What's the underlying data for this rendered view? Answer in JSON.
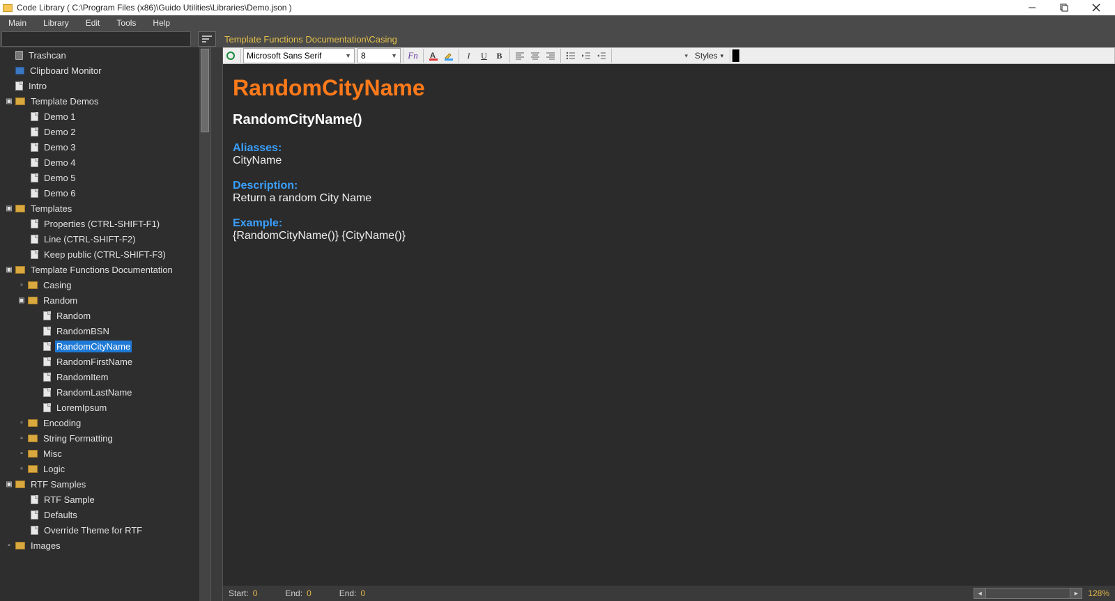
{
  "window": {
    "title": "Code Library ( C:\\Program Files (x86)\\Guido Utilities\\Libraries\\Demo.json )"
  },
  "menu": [
    "Main",
    "Library",
    "Edit",
    "Tools",
    "Help"
  ],
  "toolbar1": {
    "breadcrumb": "Template Functions Documentation\\Casing"
  },
  "editor_toolbar": {
    "font_family": "Microsoft Sans Serif",
    "font_size": "8",
    "styles_label": "Styles"
  },
  "tree": {
    "n_trashcan": "Trashcan",
    "n_clipboard": "Clipboard Monitor",
    "n_intro": "Intro",
    "n_tdemos": "Template Demos",
    "n_demo1": "Demo 1",
    "n_demo2": "Demo 2",
    "n_demo3": "Demo 3",
    "n_demo4": "Demo 4",
    "n_demo5": "Demo 5",
    "n_demo6": "Demo 6",
    "n_templates": "Templates",
    "n_props": "Properties (CTRL-SHIFT-F1)",
    "n_line": "Line (CTRL-SHIFT-F2)",
    "n_keep": "Keep public (CTRL-SHIFT-F3)",
    "n_tfd": "Template Functions Documentation",
    "n_casing": "Casing",
    "n_random": "Random",
    "n_random_item": "Random",
    "n_randombsn": "RandomBSN",
    "n_randomcity": "RandomCityName",
    "n_randomfirst": "RandomFirstName",
    "n_randomitem": "RandomItem",
    "n_randomlast": "RandomLastName",
    "n_lorem": "LoremIpsum",
    "n_encoding": "Encoding",
    "n_stringfmt": "String Formatting",
    "n_misc": "Misc",
    "n_logic": "Logic",
    "n_rtf": "RTF Samples",
    "n_rtfsample": "RTF Sample",
    "n_defaults": "Defaults",
    "n_override": "Override Theme for RTF",
    "n_images": "Images"
  },
  "doc": {
    "title": "RandomCityName",
    "signature": "RandomCityName()",
    "aliasses_label": "Aliasses:",
    "aliasses_value": "CityName",
    "description_label": "Description:",
    "description_value": "Return a random City Name",
    "example_label": "Example:",
    "example_value": "{RandomCityName()} {CityName()}"
  },
  "status": {
    "start_k": "Start:",
    "start_v": "0",
    "end1_k": "End:",
    "end1_v": "0",
    "end2_k": "End:",
    "end2_v": "0",
    "zoom": "128%"
  }
}
